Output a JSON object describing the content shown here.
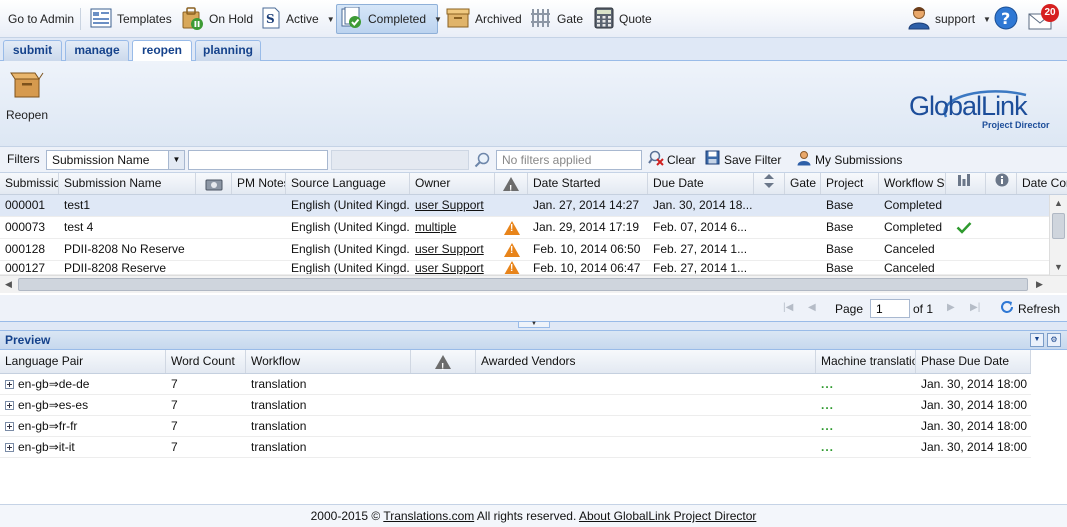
{
  "toolbar": {
    "go_to_admin": "Go to Admin",
    "templates": "Templates",
    "on_hold": "On Hold",
    "active": "Active",
    "completed": "Completed",
    "archived": "Archived",
    "gate": "Gate",
    "quote": "Quote",
    "user": "support",
    "notifications": "20"
  },
  "tabs": [
    "submit",
    "manage",
    "reopen",
    "planning"
  ],
  "ribbon": {
    "reopen_label": "Reopen",
    "logo_main": "GlobalLink",
    "logo_sub": "Project Director"
  },
  "filters": {
    "label": "Filters",
    "field": "Submission Name",
    "value": "",
    "applied_placeholder": "No filters applied",
    "clear": "Clear",
    "save_filter": "Save Filter",
    "my_submissions": "My Submissions"
  },
  "grid": {
    "headers": [
      "Submission",
      "Submission Name",
      "",
      "PM Notes",
      "Source Language",
      "Owner",
      "",
      "Date Started",
      "Due Date",
      "",
      "Gate",
      "Project",
      "Workflow Sta",
      "",
      "",
      "Date Con"
    ],
    "rows": [
      {
        "id": "000001",
        "name": "test1",
        "source": "English (United Kingd...",
        "owner": "user Support",
        "warn": false,
        "started": "Jan. 27, 2014 14:27",
        "due": "Jan. 30, 2014 18...",
        "project": "Base",
        "status": "Completed",
        "check": false,
        "selected": true
      },
      {
        "id": "000073",
        "name": "test 4",
        "source": "English (United Kingd...",
        "owner": "multiple",
        "warn": true,
        "started": "Jan. 29, 2014 17:19",
        "due": "Feb. 07, 2014 6...",
        "project": "Base",
        "status": "Completed",
        "check": true,
        "selected": false
      },
      {
        "id": "000128",
        "name": "PDII-8208 No Reserve",
        "source": "English (United Kingd...",
        "owner": "user Support",
        "warn": true,
        "started": "Feb. 10, 2014 06:50",
        "due": "Feb. 27, 2014 1...",
        "project": "Base",
        "status": "Canceled",
        "check": false,
        "selected": false
      },
      {
        "id": "000127",
        "name": "PDII-8208 Reserve",
        "source": "English (United Kingd...",
        "owner": "user Support",
        "warn": true,
        "started": "Feb. 10, 2014 06:47",
        "due": "Feb. 27, 2014 1...",
        "project": "Base",
        "status": "Canceled",
        "check": false,
        "selected": false
      }
    ]
  },
  "paging": {
    "page_label": "Page",
    "page_value": "1",
    "of_label": "of 1",
    "refresh": "Refresh"
  },
  "preview": {
    "title": "Preview",
    "headers": [
      "Language Pair",
      "Word Count",
      "Workflow",
      "",
      "Awarded Vendors",
      "Machine translation",
      "Phase Due Date"
    ],
    "rows": [
      {
        "pair": "en-gb⇒de-de",
        "words": "7",
        "workflow": "translation",
        "mt": "...",
        "due": "Jan. 30, 2014 18:00"
      },
      {
        "pair": "en-gb⇒es-es",
        "words": "7",
        "workflow": "translation",
        "mt": "...",
        "due": "Jan. 30, 2014 18:00"
      },
      {
        "pair": "en-gb⇒fr-fr",
        "words": "7",
        "workflow": "translation",
        "mt": "...",
        "due": "Jan. 30, 2014 18:00"
      },
      {
        "pair": "en-gb⇒it-it",
        "words": "7",
        "workflow": "translation",
        "mt": "...",
        "due": "Jan. 30, 2014 18:00"
      }
    ]
  },
  "footer": {
    "copyright": "2000-2015 ©",
    "company_link": "Translations.com",
    "rights": "All rights reserved.",
    "about_link": "About GlobalLink Project Director"
  },
  "colors": {
    "tab_text": "#15428b",
    "warning": "#e8841a",
    "success": "#2e9a2e",
    "accent": "#1d4e9a"
  }
}
